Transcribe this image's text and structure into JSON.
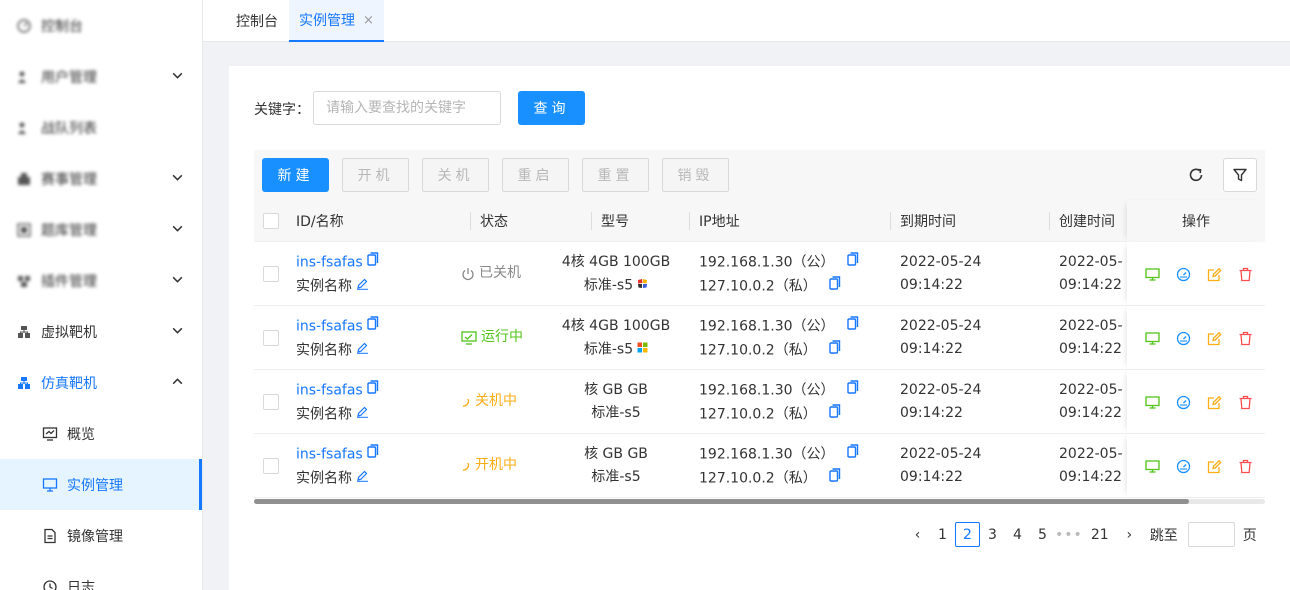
{
  "sidebar": {
    "items": [
      {
        "label": "控制台",
        "icon": "dashboard-icon"
      },
      {
        "label": "用户管理",
        "icon": "user-icon"
      },
      {
        "label": "战队列表",
        "icon": "team-icon"
      },
      {
        "label": "赛事管理",
        "icon": "competition-icon"
      },
      {
        "label": "题库管理",
        "icon": "question-bank-icon"
      },
      {
        "label": "插件管理",
        "icon": "plugin-icon"
      },
      {
        "label": "虚拟靶机",
        "icon": "virtual-target-icon"
      },
      {
        "label": "仿真靶机",
        "icon": "simulation-target-icon"
      }
    ],
    "subitems": [
      {
        "label": "概览",
        "icon": "overview-icon"
      },
      {
        "label": "实例管理",
        "icon": "monitor-icon"
      },
      {
        "label": "镜像管理",
        "icon": "image-file-icon"
      },
      {
        "label": "日志",
        "icon": "clock-icon"
      }
    ]
  },
  "tabs": {
    "home": "控制台",
    "active": "实例管理",
    "close": "×"
  },
  "search": {
    "label": "关键字：",
    "placeholder": "请输入要查找的关键字",
    "button": "查询"
  },
  "toolbar": {
    "new": "新建",
    "start": "开机",
    "shutdown": "关机",
    "restart": "重启",
    "reset": "重置",
    "destroy": "销毁"
  },
  "table": {
    "headers": {
      "id_name": "ID/名称",
      "status": "状态",
      "model": "型号",
      "ip": "IP地址",
      "expire": "到期时间",
      "created": "创建时间",
      "actions": "操作"
    },
    "rows": [
      {
        "id": "ins-fsafas",
        "name": "实例名称",
        "status": "已关机",
        "status_color": "#888888",
        "status_icon": "power-icon",
        "spec": "4核 4GB 100GB",
        "type": "标准-s5",
        "os_icon": "os-icon",
        "ip_public": "192.168.1.30（公）",
        "ip_private": "127.10.0.2（私）",
        "expire_date": "2022-05-24",
        "expire_time": "09:14:22",
        "created_date": "2022-05-",
        "created_time": "09:14:22"
      },
      {
        "id": "ins-fsafas",
        "name": "实例名称",
        "status": "运行中",
        "status_color": "#52c41a",
        "status_icon": "running-icon",
        "spec": "4核 4GB 100GB",
        "type": "标准-s5",
        "os_icon": "windows-icon",
        "ip_public": "192.168.1.30（公）",
        "ip_private": "127.10.0.2（私）",
        "expire_date": "2022-05-24",
        "expire_time": "09:14:22",
        "created_date": "2022-05-",
        "created_time": "09:14:22"
      },
      {
        "id": "ins-fsafas",
        "name": "实例名称",
        "status": "关机中",
        "status_color": "#faad14",
        "status_icon": "loading-icon",
        "spec": "核 GB GB",
        "type": "标准-s5",
        "os_icon": "",
        "ip_public": "192.168.1.30（公）",
        "ip_private": "127.10.0.2（私）",
        "expire_date": "2022-05-24",
        "expire_time": "09:14:22",
        "created_date": "2022-05-",
        "created_time": "09:14:22"
      },
      {
        "id": "ins-fsafas",
        "name": "实例名称",
        "status": "开机中",
        "status_color": "#faad14",
        "status_icon": "loading-icon",
        "spec": "核 GB GB",
        "type": "标准-s5",
        "os_icon": "",
        "ip_public": "192.168.1.30（公）",
        "ip_private": "127.10.0.2（私）",
        "expire_date": "2022-05-24",
        "expire_time": "09:14:22",
        "created_date": "2022-05-",
        "created_time": "09:14:22"
      }
    ]
  },
  "pagination": {
    "prev": "‹",
    "pages": [
      "1",
      "2",
      "3",
      "4",
      "5"
    ],
    "current": "2",
    "dots": "•••",
    "last": "21",
    "next": "›",
    "jump_label": "跳至",
    "page_suffix": "页"
  },
  "colors": {
    "accent": "#1677ff",
    "monitor": "#52c41a",
    "dashboard": "#1890ff",
    "edit": "#faad14",
    "delete": "#ff4d4f"
  }
}
